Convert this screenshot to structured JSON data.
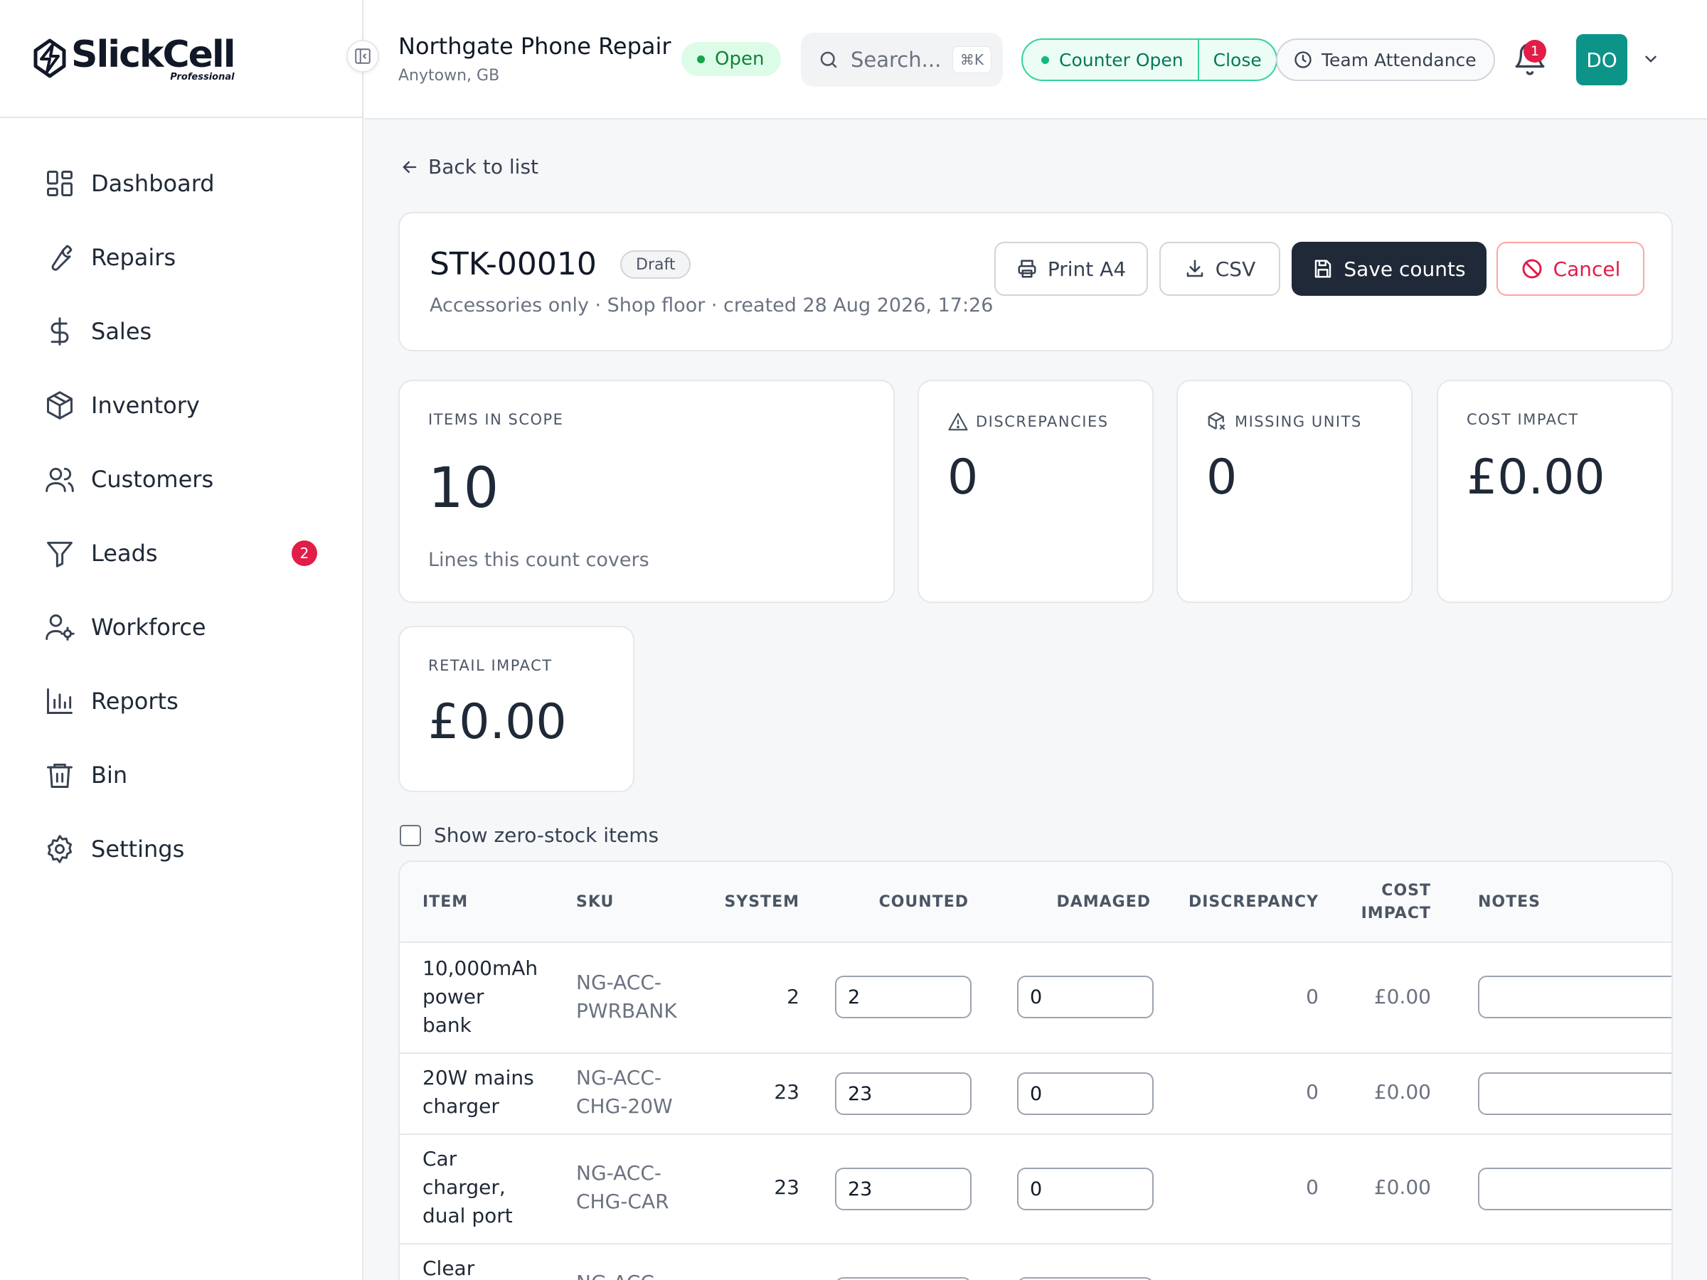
{
  "brand": {
    "name": "SlickCell",
    "subtitle": "Professional"
  },
  "sidebar": {
    "items": [
      {
        "label": "Dashboard",
        "icon": "dashboard-icon"
      },
      {
        "label": "Repairs",
        "icon": "wrench-icon"
      },
      {
        "label": "Sales",
        "icon": "dollar-icon"
      },
      {
        "label": "Inventory",
        "icon": "box-icon"
      },
      {
        "label": "Customers",
        "icon": "users-icon"
      },
      {
        "label": "Leads",
        "icon": "filter-icon",
        "badge": "2"
      },
      {
        "label": "Workforce",
        "icon": "user-gear-icon"
      },
      {
        "label": "Reports",
        "icon": "bar-chart-icon"
      },
      {
        "label": "Bin",
        "icon": "trash-icon"
      },
      {
        "label": "Settings",
        "icon": "gear-icon"
      }
    ]
  },
  "topbar": {
    "shop_name": "Northgate Phone Repair",
    "shop_location": "Anytown, GB",
    "status": "Open",
    "search_placeholder": "Search...",
    "search_shortcut": "⌘K",
    "counter_status": "Counter Open",
    "counter_close": "Close",
    "team_attendance": "Team Attendance",
    "notification_count": "1",
    "user_initials": "DO"
  },
  "page": {
    "back_label": "Back to list",
    "doc_id": "STK-00010",
    "doc_status": "Draft",
    "doc_meta": "Accessories only · Shop floor · created 28 Aug 2026, 17:26",
    "actions": {
      "print": "Print A4",
      "csv": "CSV",
      "save": "Save counts",
      "cancel": "Cancel"
    }
  },
  "stats": {
    "items_in_scope": {
      "label": "ITEMS IN SCOPE",
      "value": "10",
      "sub": "Lines this count covers"
    },
    "discrepancies": {
      "label": "DISCREPANCIES",
      "value": "0"
    },
    "missing_units": {
      "label": "MISSING UNITS",
      "value": "0"
    },
    "cost_impact": {
      "label": "COST IMPACT",
      "value": "£0.00"
    },
    "retail_impact": {
      "label": "RETAIL IMPACT",
      "value": "£0.00"
    }
  },
  "show_zero_stock": {
    "label": "Show zero-stock items",
    "checked": false
  },
  "table": {
    "headers": {
      "item": "ITEM",
      "sku": "SKU",
      "system": "SYSTEM",
      "counted": "COUNTED",
      "damaged": "DAMAGED",
      "discrepancy": "DISCREPANCY",
      "cost_impact_1": "COST",
      "cost_impact_2": "IMPACT",
      "notes": "NOTES"
    },
    "rows": [
      {
        "item": [
          "10,000mAh",
          "power",
          "bank"
        ],
        "sku": [
          "NG-ACC-",
          "PWRBANK"
        ],
        "system": "2",
        "counted": "2",
        "damaged": "0",
        "discrepancy": "0",
        "cost_impact": "£0.00",
        "notes": ""
      },
      {
        "item": [
          "20W mains",
          "charger"
        ],
        "sku": [
          "NG-ACC-",
          "CHG-20W"
        ],
        "system": "23",
        "counted": "23",
        "damaged": "0",
        "discrepancy": "0",
        "cost_impact": "£0.00",
        "notes": ""
      },
      {
        "item": [
          "Car",
          "charger,",
          "dual port"
        ],
        "sku": [
          "NG-ACC-",
          "CHG-CAR"
        ],
        "system": "23",
        "counted": "23",
        "damaged": "0",
        "discrepancy": "0",
        "cost_impact": "£0.00",
        "notes": ""
      },
      {
        "item": [
          "Clear"
        ],
        "sku": [
          "NG-ACC-"
        ],
        "system": "",
        "counted": "",
        "damaged": "",
        "discrepancy": "",
        "cost_impact": "",
        "notes": ""
      }
    ]
  }
}
